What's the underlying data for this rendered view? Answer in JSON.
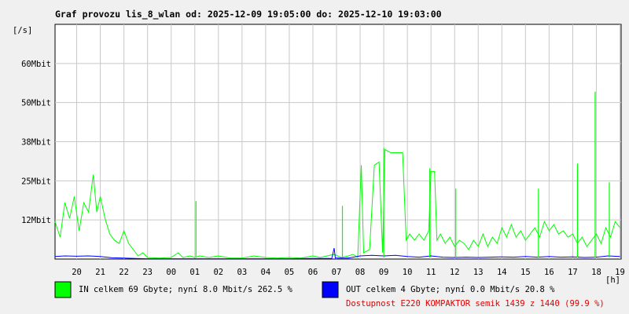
{
  "chart_data": {
    "type": "line",
    "title": "Graf provozu lis_8_wlan od: 2025-12-09 19:05:00 do: 2025-12-10 19:03:00",
    "ylabel": "[/s]",
    "xlabel": "[h]",
    "ylim": [
      0,
      75
    ],
    "y_unit": "Mbit/s",
    "y_ticks": [
      {
        "value": 12.5,
        "label": "12Mbit"
      },
      {
        "value": 25,
        "label": "25Mbit"
      },
      {
        "value": 37.5,
        "label": "38Mbit"
      },
      {
        "value": 50,
        "label": "50Mbit"
      },
      {
        "value": 62.5,
        "label": "60Mbit"
      }
    ],
    "x_range_hours": [
      19.083,
      43.05
    ],
    "x_ticks": [
      {
        "value": 20,
        "label": "20"
      },
      {
        "value": 21,
        "label": "21"
      },
      {
        "value": 22,
        "label": "22"
      },
      {
        "value": 23,
        "label": "23"
      },
      {
        "value": 24,
        "label": "00"
      },
      {
        "value": 25,
        "label": "01"
      },
      {
        "value": 26,
        "label": "02"
      },
      {
        "value": 27,
        "label": "03"
      },
      {
        "value": 28,
        "label": "04"
      },
      {
        "value": 29,
        "label": "05"
      },
      {
        "value": 30,
        "label": "06"
      },
      {
        "value": 31,
        "label": "07"
      },
      {
        "value": 32,
        "label": "08"
      },
      {
        "value": 33,
        "label": "09"
      },
      {
        "value": 34,
        "label": "10"
      },
      {
        "value": 35,
        "label": "11"
      },
      {
        "value": 36,
        "label": "12"
      },
      {
        "value": 37,
        "label": "13"
      },
      {
        "value": 38,
        "label": "14"
      },
      {
        "value": 39,
        "label": "15"
      },
      {
        "value": 40,
        "label": "16"
      },
      {
        "value": 41,
        "label": "17"
      },
      {
        "value": 42,
        "label": "18"
      },
      {
        "value": 43,
        "label": "19"
      }
    ],
    "grid": true,
    "series": [
      {
        "name": "IN",
        "color": "#00ff00",
        "points": [
          [
            19.08,
            12
          ],
          [
            19.3,
            7
          ],
          [
            19.5,
            18
          ],
          [
            19.7,
            13
          ],
          [
            19.9,
            20
          ],
          [
            20.1,
            9
          ],
          [
            20.3,
            18
          ],
          [
            20.5,
            15
          ],
          [
            20.7,
            27
          ],
          [
            20.85,
            15
          ],
          [
            21.0,
            20
          ],
          [
            21.2,
            13
          ],
          [
            21.4,
            8
          ],
          [
            21.6,
            6
          ],
          [
            21.8,
            5
          ],
          [
            22.0,
            9
          ],
          [
            22.2,
            5
          ],
          [
            22.4,
            3
          ],
          [
            22.6,
            1
          ],
          [
            22.8,
            2
          ],
          [
            23.0,
            0.5
          ],
          [
            23.5,
            0.3
          ],
          [
            24.0,
            0.5
          ],
          [
            24.3,
            2
          ],
          [
            24.5,
            0.5
          ],
          [
            24.8,
            1
          ],
          [
            25.0,
            0.5
          ],
          [
            25.2,
            1
          ],
          [
            25.6,
            0.5
          ],
          [
            26.0,
            1
          ],
          [
            26.5,
            0.3
          ],
          [
            27.0,
            0.3
          ],
          [
            27.5,
            1
          ],
          [
            28.0,
            0.5
          ],
          [
            28.5,
            0.3
          ],
          [
            29.0,
            0.5
          ],
          [
            29.5,
            0.3
          ],
          [
            30.0,
            1
          ],
          [
            30.3,
            0.5
          ],
          [
            30.6,
            1
          ],
          [
            30.9,
            1.5
          ],
          [
            31.2,
            0.5
          ],
          [
            31.5,
            1
          ],
          [
            31.7,
            1.5
          ],
          [
            31.9,
            0.5
          ],
          [
            32.05,
            30
          ],
          [
            32.15,
            2
          ],
          [
            32.4,
            3
          ],
          [
            32.6,
            30
          ],
          [
            32.8,
            31
          ],
          [
            32.95,
            2
          ],
          [
            33.05,
            35
          ],
          [
            33.3,
            34
          ],
          [
            33.6,
            34
          ],
          [
            33.8,
            34
          ],
          [
            33.95,
            6
          ],
          [
            34.1,
            8
          ],
          [
            34.3,
            6
          ],
          [
            34.5,
            8
          ],
          [
            34.7,
            6
          ],
          [
            34.9,
            9
          ],
          [
            35.0,
            28
          ],
          [
            35.15,
            28
          ],
          [
            35.25,
            6
          ],
          [
            35.4,
            8
          ],
          [
            35.6,
            5
          ],
          [
            35.8,
            7
          ],
          [
            36.0,
            4
          ],
          [
            36.2,
            6
          ],
          [
            36.4,
            5
          ],
          [
            36.6,
            3
          ],
          [
            36.8,
            6
          ],
          [
            37.0,
            4
          ],
          [
            37.2,
            8
          ],
          [
            37.4,
            4
          ],
          [
            37.6,
            7
          ],
          [
            37.8,
            5
          ],
          [
            38.0,
            10
          ],
          [
            38.2,
            7
          ],
          [
            38.4,
            11
          ],
          [
            38.6,
            7
          ],
          [
            38.8,
            9
          ],
          [
            39.0,
            6
          ],
          [
            39.2,
            8
          ],
          [
            39.4,
            10
          ],
          [
            39.6,
            7
          ],
          [
            39.8,
            12
          ],
          [
            40.0,
            9
          ],
          [
            40.2,
            11
          ],
          [
            40.4,
            8
          ],
          [
            40.6,
            9
          ],
          [
            40.8,
            7
          ],
          [
            41.0,
            8
          ],
          [
            41.2,
            5
          ],
          [
            41.4,
            7
          ],
          [
            41.6,
            4
          ],
          [
            41.8,
            6
          ],
          [
            42.0,
            8
          ],
          [
            42.2,
            5
          ],
          [
            42.4,
            10
          ],
          [
            42.6,
            7
          ],
          [
            42.8,
            12
          ],
          [
            43.0,
            10
          ]
        ]
      },
      {
        "name": "OUT",
        "color": "#0000ff",
        "points": [
          [
            19.08,
            0.8
          ],
          [
            19.5,
            1.0
          ],
          [
            20.0,
            0.9
          ],
          [
            20.5,
            1.0
          ],
          [
            21.0,
            0.8
          ],
          [
            21.5,
            0.4
          ],
          [
            22.0,
            0.3
          ],
          [
            22.5,
            0.2
          ],
          [
            23.0,
            0.1
          ],
          [
            24.0,
            0.1
          ],
          [
            25.0,
            0.1
          ],
          [
            26.0,
            0.1
          ],
          [
            27.0,
            0.1
          ],
          [
            28.0,
            0.1
          ],
          [
            29.0,
            0.1
          ],
          [
            30.0,
            0.2
          ],
          [
            30.8,
            0.2
          ],
          [
            30.9,
            3.5
          ],
          [
            30.95,
            0.3
          ],
          [
            31.5,
            0.3
          ],
          [
            32.0,
            1.0
          ],
          [
            32.5,
            1.2
          ],
          [
            33.0,
            1.0
          ],
          [
            33.5,
            1.2
          ],
          [
            34.0,
            0.8
          ],
          [
            34.5,
            0.6
          ],
          [
            35.0,
            1.0
          ],
          [
            35.5,
            0.6
          ],
          [
            36.0,
            0.5
          ],
          [
            36.5,
            0.6
          ],
          [
            37.0,
            0.5
          ],
          [
            37.5,
            0.6
          ],
          [
            38.0,
            0.7
          ],
          [
            38.5,
            0.6
          ],
          [
            39.0,
            0.8
          ],
          [
            39.5,
            0.6
          ],
          [
            40.0,
            0.8
          ],
          [
            40.5,
            0.6
          ],
          [
            41.0,
            0.7
          ],
          [
            41.5,
            0.5
          ],
          [
            42.0,
            0.6
          ],
          [
            42.5,
            1.0
          ],
          [
            43.0,
            0.8
          ]
        ]
      }
    ],
    "spikes": [
      {
        "series": "IN",
        "x": 25.05,
        "value": 18.5
      },
      {
        "series": "IN",
        "x": 31.25,
        "value": 17
      },
      {
        "series": "IN",
        "x": 33.0,
        "value": 35.5
      },
      {
        "series": "IN",
        "x": 34.95,
        "value": 29
      },
      {
        "series": "IN",
        "x": 36.05,
        "value": 22.5
      },
      {
        "series": "IN",
        "x": 39.55,
        "value": 22.5
      },
      {
        "series": "IN",
        "x": 41.2,
        "value": 30.5
      },
      {
        "series": "IN",
        "x": 41.95,
        "value": 53.5
      },
      {
        "series": "IN",
        "x": 42.55,
        "value": 24.5
      }
    ]
  },
  "legend": {
    "in_text": "IN celkem 69 Gbyte; nyní   8.0 Mbit/s 262.5 %",
    "out_text": "OUT celkem 4 Gbyte; nyní   0.0 Mbit/s 20.8 %",
    "availability_text": "Dostupnost E220 KOMPAKTOR semik 1439 z 1440 (99.9 %)",
    "in_color": "#00ff00",
    "out_color": "#0000ff",
    "availability_color": "#e00000"
  }
}
